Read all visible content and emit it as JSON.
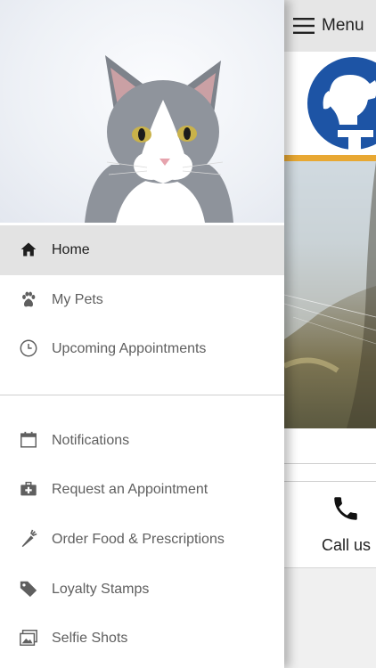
{
  "header": {
    "menu_label": "Menu"
  },
  "call": {
    "label": "Call us"
  },
  "colors": {
    "accent_orange": "#e8a833",
    "logo_blue": "#1d54a5",
    "active_bg": "#e3e3e3"
  },
  "drawer": {
    "items": [
      {
        "label": "Home",
        "icon": "home-icon",
        "active": true
      },
      {
        "label": "My Pets",
        "icon": "paw-icon"
      },
      {
        "label": "Upcoming Appointments",
        "icon": "clock-icon"
      },
      {
        "label": "Notifications",
        "icon": "calendar-icon"
      },
      {
        "label": "Request an Appointment",
        "icon": "medical-kit-icon"
      },
      {
        "label": "Order Food & Prescriptions",
        "icon": "carrot-icon"
      },
      {
        "label": "Loyalty Stamps",
        "icon": "tag-icon"
      },
      {
        "label": "Selfie Shots",
        "icon": "photos-icon"
      }
    ]
  }
}
